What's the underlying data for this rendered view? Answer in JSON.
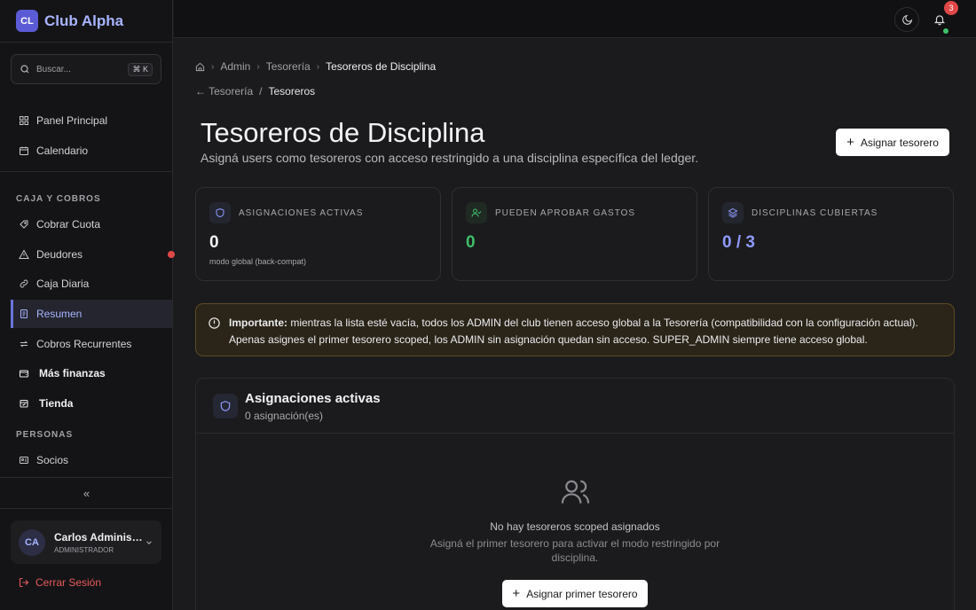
{
  "brand": {
    "logo": "CL",
    "name": "Club Alpha"
  },
  "search": {
    "placeholder": "Buscar...",
    "shortcut": "⌘ K"
  },
  "sidebar": {
    "top_items": [
      {
        "label": "Panel Principal",
        "icon": "grid-icon"
      },
      {
        "label": "Calendario",
        "icon": "calendar-icon"
      }
    ],
    "section_caja": "CAJA Y COBROS",
    "caja_items": [
      {
        "label": "Cobrar Cuota",
        "icon": "receipt-icon"
      },
      {
        "label": "Deudores",
        "icon": "warning-icon"
      },
      {
        "label": "Caja Diaria",
        "icon": "wallet-icon"
      },
      {
        "label": "Resumen",
        "icon": "file-icon"
      },
      {
        "label": "Cobros Recurrentes",
        "icon": "repeat-icon"
      },
      {
        "label": "Más finanzas",
        "icon": "wallet-icon"
      },
      {
        "label": "Tienda",
        "icon": "store-icon"
      }
    ],
    "section_personas": "PERSONAS",
    "personas_items": [
      {
        "label": "Socios",
        "icon": "id-card-icon"
      }
    ],
    "collapse_label": "«"
  },
  "user": {
    "initials": "CA",
    "name": "Carlos Administrador",
    "role": "ADMINISTRADOR"
  },
  "logout_label": "Cerrar Sesión",
  "topbar": {
    "notifications_count": "3"
  },
  "breadcrumb": {
    "items": [
      "Admin",
      "Tesorería",
      "Tesoreros de Disciplina"
    ]
  },
  "subcrumb": {
    "back": "← Tesorería",
    "separator": "/",
    "current": "Tesoreros"
  },
  "page": {
    "title": "Tesoreros de Disciplina",
    "subtitle": "Asigná users como tesoreros con acceso restringido a una disciplina específica del ledger.",
    "primary_action": "Asignar tesorero"
  },
  "stats": [
    {
      "label": "ASIGNACIONES ACTIVAS",
      "value": "0",
      "note": "modo global (back-compat)",
      "color": "#f2f2f4",
      "icon": "shield-icon"
    },
    {
      "label": "PUEDEN APROBAR GASTOS",
      "value": "0",
      "note": "",
      "color": "#3fbf6a",
      "icon": "user-check-icon"
    },
    {
      "label": "DISCIPLINAS CUBIERTAS",
      "value": "0 / 3",
      "note": "",
      "color": "#8f9bff",
      "icon": "layers-icon"
    }
  ],
  "alert": {
    "strong": "Importante:",
    "line1": " mientras la lista esté vacía, todos los ADMIN del club tienen acceso global a la Tesorería (compatibilidad con la configuración actual).",
    "line2": "Apenas asignes el primer tesorero scoped, los ADMIN sin asignación quedan sin acceso. SUPER_ADMIN siempre tiene acceso global."
  },
  "panel": {
    "title": "Asignaciones activas",
    "subtitle": "0 asignación(es)",
    "empty_title": "No hay tesoreros scoped asignados",
    "empty_desc": "Asigná el primer tesorero para activar el modo restringido por disciplina.",
    "empty_action": "Asignar primer tesorero"
  }
}
